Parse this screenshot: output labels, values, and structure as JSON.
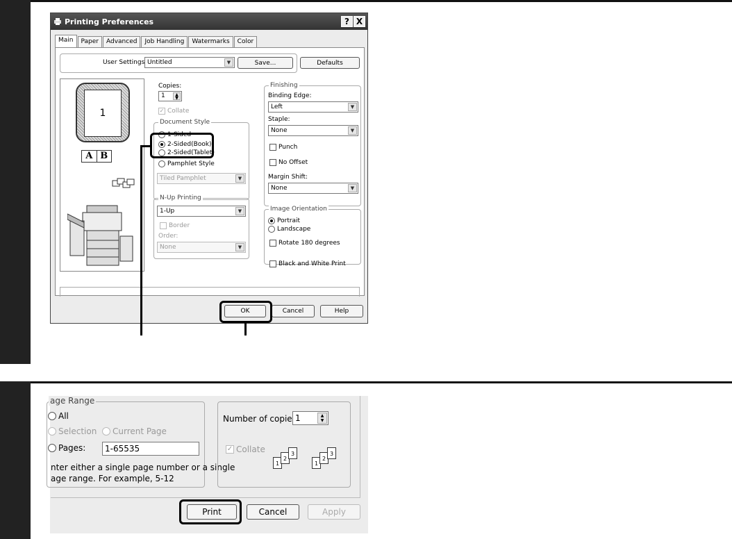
{
  "dialog1": {
    "title": "Printing Preferences",
    "help_btn": "?",
    "close_btn": "X",
    "tabs": [
      "Main",
      "Paper",
      "Advanced",
      "Job Handling",
      "Watermarks",
      "Color"
    ],
    "user_settings_label": "User Settings:",
    "user_settings_value": "Untitled",
    "save_label": "Save...",
    "defaults_label": "Defaults",
    "preview_page_number": "1",
    "preview_binding_a": "A",
    "preview_binding_b": "B",
    "copies_label": "Copies:",
    "copies_value": "1",
    "collate_label": "Collate",
    "document_style_label": "Document Style",
    "doc_1sided": "1-Sided",
    "doc_2sided_book": "2-Sided(Book)",
    "doc_2sided_tablet": "2-Sided(Tablet)",
    "pamphlet_style": "Pamphlet Style",
    "pamphlet_combo": "Tiled Pamphlet",
    "nup_label": "N-Up Printing",
    "nup_value": "1-Up",
    "border_label": "Border",
    "order_label": "Order:",
    "order_value": "None",
    "finishing_label": "Finishing",
    "binding_edge_label": "Binding Edge:",
    "binding_edge_value": "Left",
    "staple_label": "Staple:",
    "staple_value": "None",
    "punch_label": "Punch",
    "no_offset_label": "No Offset",
    "margin_shift_label": "Margin Shift:",
    "margin_shift_value": "None",
    "image_orientation_label": "Image Orientation",
    "portrait_label": "Portrait",
    "landscape_label": "Landscape",
    "rotate_label": "Rotate 180 degrees",
    "bw_label": "Black and White Print",
    "ok_label": "OK",
    "cancel_label": "Cancel",
    "help_label": "Help"
  },
  "dialog2": {
    "page_range_label": "age Range",
    "all_label": "All",
    "selection_label": "Selection",
    "current_page_label": "Current Page",
    "pages_label": "Pages:",
    "pages_value": "1-65535",
    "hint_line1": "nter either a single page number or a single",
    "hint_line2": "age range.  For example, 5-12",
    "num_copies_label": "Number of copies:",
    "num_copies_value": "1",
    "collate_label": "Collate",
    "collate_pages": [
      "1",
      "2",
      "3"
    ],
    "print_label": "Print",
    "cancel_label": "Cancel",
    "apply_label": "Apply"
  }
}
